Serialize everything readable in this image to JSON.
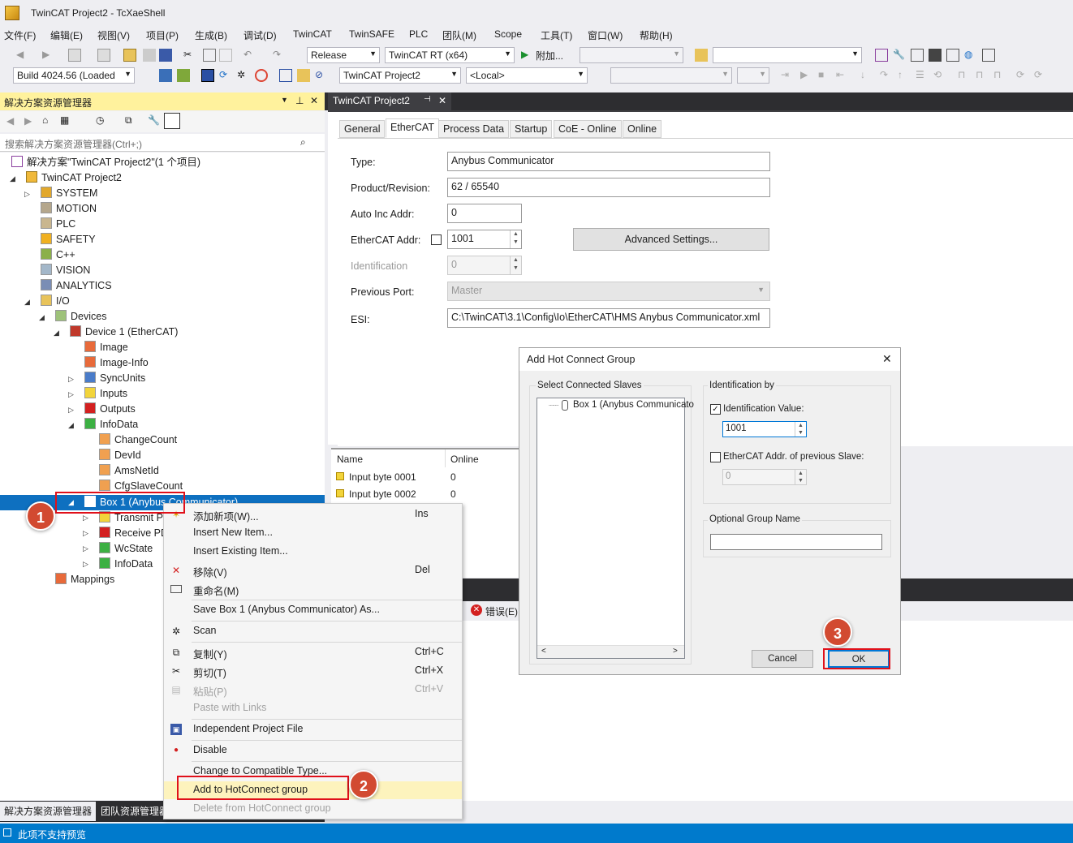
{
  "window": {
    "title": "TwinCAT Project2 - TcXaeShell"
  },
  "menu": [
    "文件(F)",
    "编辑(E)",
    "视图(V)",
    "项目(P)",
    "生成(B)",
    "调试(D)",
    "TwinCAT",
    "TwinSAFE",
    "PLC",
    "团队(M)",
    "Scope",
    "工具(T)",
    "窗口(W)",
    "帮助(H)"
  ],
  "toolbar": {
    "config": "Release",
    "platform": "TwinCAT RT (x64)",
    "attach": "附加...",
    "build": "Build 4024.56 (Loaded",
    "project": "TwinCAT Project2",
    "target": "<Local>"
  },
  "solution_explorer": {
    "title": "解决方案资源管理器",
    "search_placeholder": "搜索解决方案资源管理器(Ctrl+;)",
    "tree": [
      "解决方案\"TwinCAT Project2\"(1 个项目)",
      "TwinCAT Project2",
      "SYSTEM",
      "MOTION",
      "PLC",
      "SAFETY",
      "C++",
      "VISION",
      "ANALYTICS",
      "I/O",
      "Devices",
      "Device 1 (EtherCAT)",
      "Image",
      "Image-Info",
      "SyncUnits",
      "Inputs",
      "Outputs",
      "InfoData",
      "ChangeCount",
      "DevId",
      "AmsNetId",
      "CfgSlaveCount",
      "Box 1 (Anybus Communicator)",
      "Transmit PDO",
      "Receive PDO",
      "WcState",
      "InfoData",
      "Mappings"
    ],
    "bottom_tabs": [
      "解决方案资源管理器",
      "团队资源管理器"
    ]
  },
  "document": {
    "tab_title": "TwinCAT Project2",
    "tabs": [
      "General",
      "EtherCAT",
      "Process Data",
      "Startup",
      "CoE - Online",
      "Online"
    ],
    "fields": {
      "type_label": "Type:",
      "type_value": "Anybus Communicator",
      "product_label": "Product/Revision:",
      "product_value": "62 / 65540",
      "autoinc_label": "Auto Inc Addr:",
      "autoinc_value": "0",
      "ecaddr_label": "EtherCAT Addr:",
      "ecaddr_value": "1001",
      "ident_label": "Identification",
      "ident_value": "0",
      "prevport_label": "Previous Port:",
      "prevport_value": "Master",
      "esi_label": "ESI:",
      "esi_value": "C:\\TwinCAT\\3.1\\Config\\Io\\EtherCAT\\HMS Anybus Communicator.xml"
    },
    "advanced_button": "Advanced Settings..."
  },
  "grid": {
    "headers": [
      "Name",
      "Online"
    ],
    "rows": [
      {
        "name": "Input byte 0001",
        "online": "0"
      },
      {
        "name": "Input byte 0002",
        "online": "0"
      }
    ]
  },
  "output": {
    "errors_label": "错误(E)"
  },
  "context_menu": {
    "items": [
      {
        "label": "添加新项(W)...",
        "shortcut": "Ins"
      },
      {
        "label": "Insert New Item...",
        "shortcut": ""
      },
      {
        "label": "Insert Existing Item...",
        "shortcut": ""
      },
      {
        "label": "移除(V)",
        "shortcut": "Del"
      },
      {
        "label": "重命名(M)",
        "shortcut": ""
      },
      {
        "label": "Save Box 1 (Anybus Communicator) As...",
        "shortcut": ""
      },
      {
        "label": "Scan",
        "shortcut": ""
      },
      {
        "label": "复制(Y)",
        "shortcut": "Ctrl+C"
      },
      {
        "label": "剪切(T)",
        "shortcut": "Ctrl+X"
      },
      {
        "label": "粘贴(P)",
        "shortcut": "Ctrl+V"
      },
      {
        "label": "Paste with Links",
        "shortcut": ""
      },
      {
        "label": "Independent Project File",
        "shortcut": ""
      },
      {
        "label": "Disable",
        "shortcut": ""
      },
      {
        "label": "Change to Compatible Type...",
        "shortcut": ""
      },
      {
        "label": "Add to HotConnect group",
        "shortcut": ""
      },
      {
        "label": "Delete from HotConnect group",
        "shortcut": ""
      }
    ]
  },
  "dialog": {
    "title": "Add Hot Connect Group",
    "select_group": "Select Connected Slaves",
    "slave_item": "Box 1 (Anybus Communicato",
    "ident_group": "Identification by",
    "ident_value_label": "Identification Value:",
    "ident_value": "1001",
    "prev_addr_label": "EtherCAT Addr. of previous Slave:",
    "prev_addr_value": "0",
    "optional_group": "Optional Group Name",
    "optional_value": "",
    "cancel": "Cancel",
    "ok": "OK"
  },
  "markers": [
    "1",
    "2",
    "3"
  ],
  "status": {
    "text": "此项不支持预览"
  },
  "colors": {
    "selection": "#0e70c0",
    "status_bar": "#007acc",
    "highlight": "#fff29d",
    "marker": "#d24a31",
    "annotation_box": "#e0101a"
  }
}
